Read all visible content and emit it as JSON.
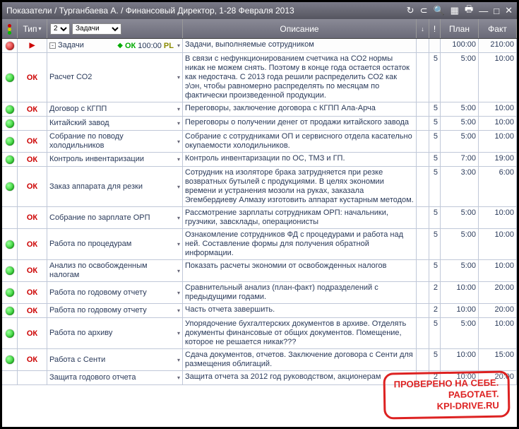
{
  "title": "Показатели / Турганбаева А. / Финансовый Директор, 1-28 Февраля 2013",
  "headers": {
    "type": "Тип",
    "desc": "Описание",
    "plan": "План",
    "fact": "Факт",
    "sel_num": "2",
    "sel_task": "Задачи"
  },
  "firstrow": {
    "task_label": "Задачи",
    "ok": "ОК",
    "time": "100:00",
    "pl": "PL",
    "desc": "Задачи, выполняемые сотрудником",
    "plan": "100:00",
    "fact": "210:00"
  },
  "rows": [
    {
      "status": "green",
      "type": "ОК",
      "task": "Расчет СО2",
      "desc": "В связи с нефункционированием счетчика на СО2 нормы никак не можем снять. Поэтому в конце года остается остаток как недостача. С 2013 года решили распределить СО2 как э\\эн, чтобы равномерно распределять по месяцам по фактически произведенной продукции.",
      "excl": "5",
      "plan": "5:00",
      "fact": "10:00"
    },
    {
      "status": "green",
      "type": "ОК",
      "task": "Договор с КГПП",
      "desc": "Переговоры, заключение договора с КГПП Ала-Арча",
      "excl": "5",
      "plan": "5:00",
      "fact": "10:00"
    },
    {
      "status": "green",
      "type": "",
      "task": "Китайский завод",
      "desc": "Переговоры о получении денег от продажи китайского завода",
      "excl": "5",
      "plan": "5:00",
      "fact": "10:00"
    },
    {
      "status": "green",
      "type": "ОК",
      "task": "Собрание по поводу холодильников",
      "desc": "Собрание с сотрудниками ОП и сервисного отдела касательно окупаемости холодильников.",
      "excl": "5",
      "plan": "5:00",
      "fact": "10:00"
    },
    {
      "status": "green",
      "type": "ОК",
      "task": "Контроль инвентаризации",
      "desc": "Контроль инвентаризации по ОС, ТМЗ и ГП.",
      "excl": "5",
      "plan": "7:00",
      "fact": "19:00"
    },
    {
      "status": "green",
      "type": "ОК",
      "task": "Заказ аппарата для резки",
      "desc": "Сотрудник на изоляторе брака затрудняется при резке возвратных бутылей с продукциями. В целях экономии времени и устранения мозоли на руках, заказала Эгембердиеву Алмазу изготовить аппарат кустарным методом.",
      "excl": "5",
      "plan": "3:00",
      "fact": "6:00"
    },
    {
      "status": "",
      "type": "ОК",
      "task": "Собрание по зарплате ОРП",
      "desc": "Рассмотрение зарплаты сотрудникам ОРП: начальники, грузчики, завсклады, операционисты",
      "excl": "5",
      "plan": "5:00",
      "fact": "10:00"
    },
    {
      "status": "green",
      "type": "ОК",
      "task": "Работа по процедурам",
      "desc": "Ознакомление сотрудников ФД с процедурами и работа над ней. Составление формы для получения обратной информации.",
      "excl": "5",
      "plan": "5:00",
      "fact": "10:00"
    },
    {
      "status": "green",
      "type": "ОК",
      "task": "Анализ по освобожденным налогам",
      "desc": "Показать расчеты экономии от освобожденных налогов",
      "excl": "5",
      "plan": "5:00",
      "fact": "10:00"
    },
    {
      "status": "green",
      "type": "ОК",
      "task": "Работа по годовому отчету",
      "desc": "Сравнительный анализ (план-факт) подразделений с предыдущими годами.",
      "excl": "2",
      "plan": "10:00",
      "fact": "20:00"
    },
    {
      "status": "green",
      "type": "ОК",
      "task": "Работа по годовому отчету",
      "desc": "Часть отчета завершить.",
      "excl": "2",
      "plan": "10:00",
      "fact": "20:00"
    },
    {
      "status": "green",
      "type": "ОК",
      "task": "Работа по архиву",
      "desc": "Упорядочение бухгалтерских документов в архиве. Отделять документы финансовые от общих документов. Помещение, которое не решается никак???",
      "excl": "5",
      "plan": "5:00",
      "fact": "10:00"
    },
    {
      "status": "green",
      "type": "ОК",
      "task": "Работа с Сенти",
      "desc": "Сдача документов, отчетов. Заключение договора с Сенти для размещения облигаций.",
      "excl": "5",
      "plan": "10:00",
      "fact": "15:00"
    },
    {
      "status": "",
      "type": "",
      "task": "Защита годового отчета",
      "desc": "Защита отчета за 2012 год руководством, акционерам",
      "excl": "2",
      "plan": "10:00",
      "fact": "20:00"
    }
  ],
  "stamp": {
    "l1": "ПРОВЕРЕНО НА СЕБЕ.",
    "l2": "РАБОТАЕТ.",
    "l3": "KPI-DRIVE.RU"
  }
}
